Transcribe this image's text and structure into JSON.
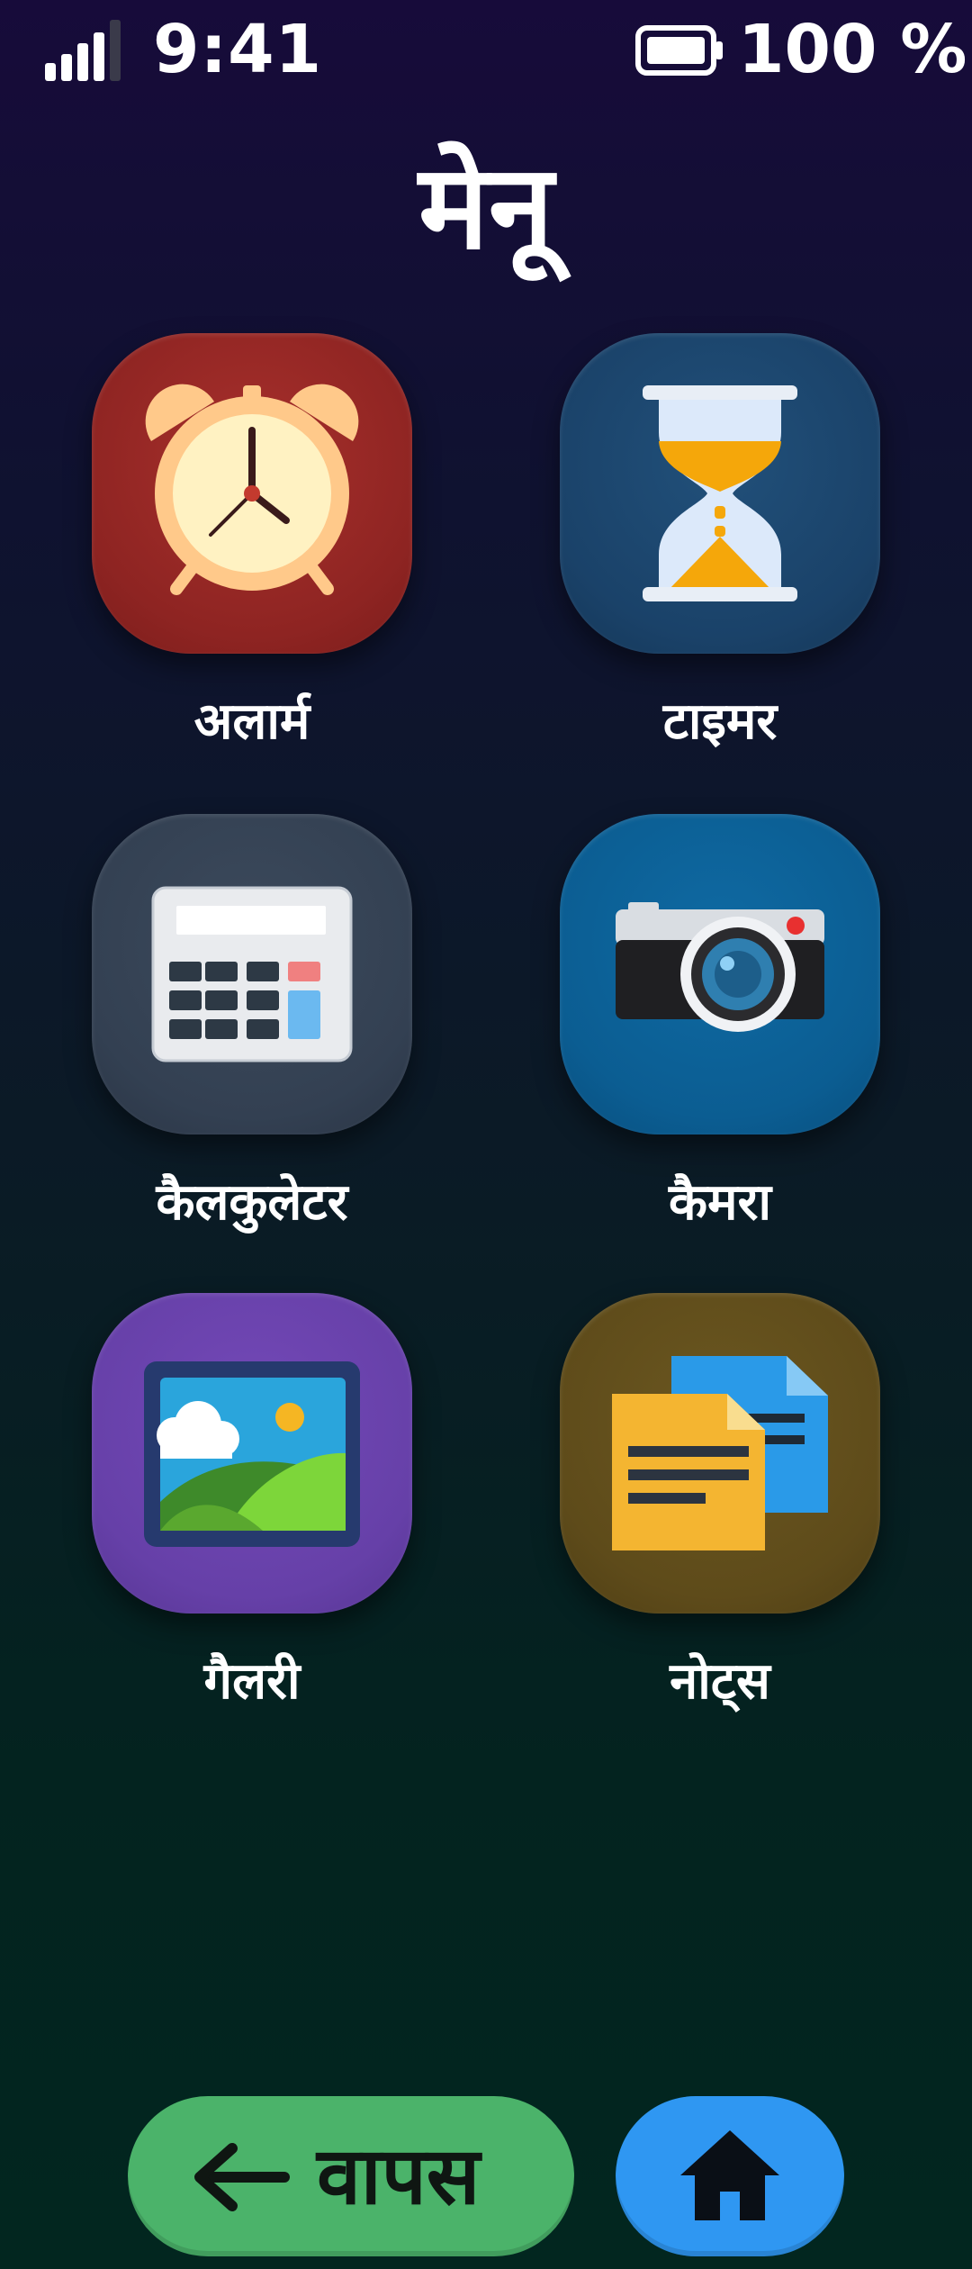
{
  "status_bar": {
    "time": "9:41",
    "battery_percent": "100 %",
    "signal_icon": "signal-bars-icon",
    "battery_icon": "battery-full-icon"
  },
  "title": "मेनू",
  "apps": [
    {
      "label": "अलार्म",
      "icon": "alarm-clock-icon",
      "color": "#8e2422"
    },
    {
      "label": "टाइमर",
      "icon": "hourglass-icon",
      "color": "#1a4269"
    },
    {
      "label": "कैलकुलेटर",
      "icon": "calculator-icon",
      "color": "#334052"
    },
    {
      "label": "कैमरा",
      "icon": "camera-icon",
      "color": "#0b5d92"
    },
    {
      "label": "गैलरी",
      "icon": "gallery-picture-icon",
      "color": "#6640a8"
    },
    {
      "label": "नोट्स",
      "icon": "notes-documents-icon",
      "color": "#5e4b1a"
    }
  ],
  "nav": {
    "back_label": "वापस",
    "back_icon": "left-arrow-icon",
    "home_icon": "home-icon",
    "back_color": "#4bb36a",
    "home_color": "#2f97f2"
  }
}
